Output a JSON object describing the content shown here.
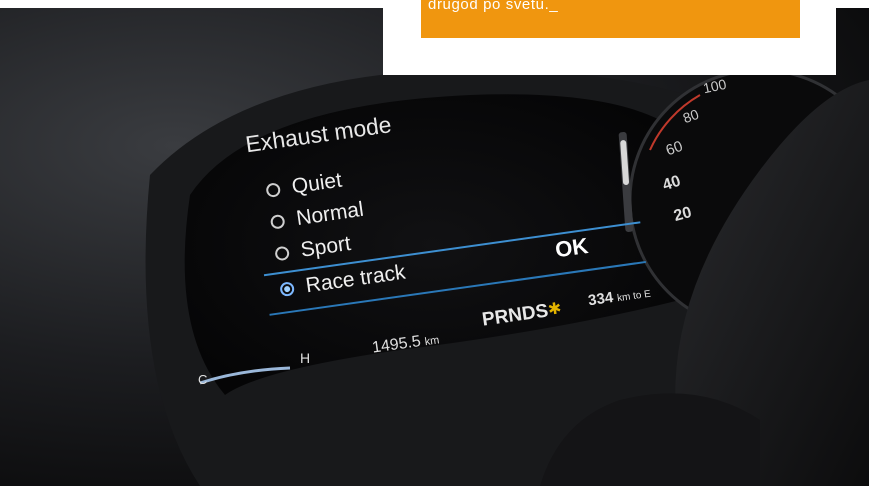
{
  "overlay": {
    "text": "drugod po svetu._"
  },
  "display": {
    "title": "Exhaust mode",
    "options": [
      {
        "label": "Quiet",
        "selected": false
      },
      {
        "label": "Normal",
        "selected": false
      },
      {
        "label": "Sport",
        "selected": false
      },
      {
        "label": "Race track",
        "selected": true
      }
    ],
    "ok_label": "OK",
    "odometer": "1495.5",
    "odometer_unit": "km",
    "gear_indicator": "PRNDS",
    "range_value": "334",
    "range_unit": "km to E",
    "temp_high": "H",
    "temp_low": "C"
  },
  "speedometer": {
    "ticks": [
      "100",
      "80",
      "60",
      "40",
      "20"
    ]
  },
  "colors": {
    "overlay_orange": "#f0960f",
    "accent_blue": "#3d8fd1",
    "gauge_red": "#c0392b"
  }
}
